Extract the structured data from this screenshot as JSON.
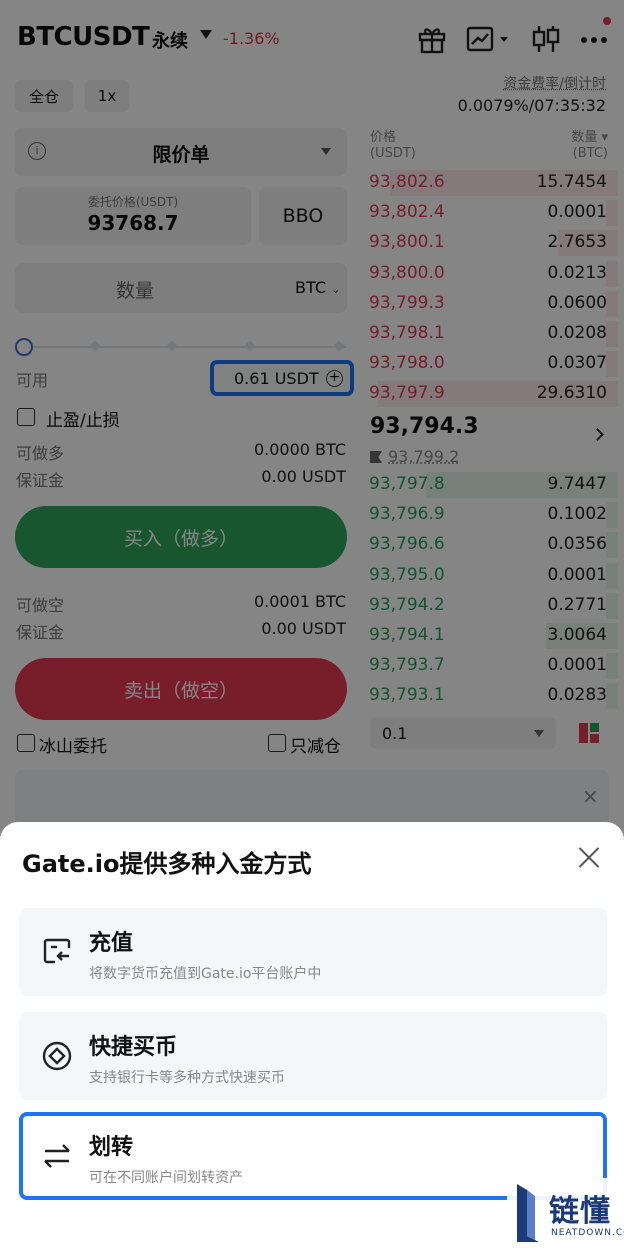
{
  "header": {
    "pair": "BTCUSDT",
    "contract_type": "永续",
    "change": "-1.36%",
    "funding_label": "资金费率/倒计时",
    "funding_value": "0.0079%/07:35:32",
    "icons": [
      "gift-icon",
      "chart-icon",
      "candlestick-icon",
      "more-icon"
    ]
  },
  "controls": {
    "margin_mode": "全仓",
    "leverage": "1x"
  },
  "order_form": {
    "order_type": "限价单",
    "price_label": "委托价格(USDT)",
    "price_value": "93768.7",
    "bbo": "BBO",
    "quantity_placeholder": "数量",
    "quantity_unit": "BTC",
    "available_label": "可用",
    "available_value": "0.61 USDT",
    "tp_sl": "止盈/止损",
    "long_max_label": "可做多",
    "long_max_value": "0.0000 BTC",
    "long_margin_label": "保证金",
    "long_margin_value": "0.00 USDT",
    "buy_button": "买入（做多）",
    "short_max_label": "可做空",
    "short_max_value": "0.0001 BTC",
    "short_margin_label": "保证金",
    "short_margin_value": "0.00 USDT",
    "sell_button": "卖出（做空）",
    "iceberg": "冰山委托",
    "reduce_only": "只减仓"
  },
  "orderbook": {
    "price_header": "价格\n(USDT)",
    "qty_header": "数量 ▾\n(BTC)",
    "asks": [
      {
        "price": "93,802.6",
        "qty": "15.7454",
        "depth": 0.95
      },
      {
        "price": "93,802.4",
        "qty": "0.0001",
        "depth": 0.05
      },
      {
        "price": "93,800.1",
        "qty": "2.7653",
        "depth": 0.25
      },
      {
        "price": "93,800.0",
        "qty": "0.0213",
        "depth": 0.05
      },
      {
        "price": "93,799.3",
        "qty": "0.0600",
        "depth": 0.05
      },
      {
        "price": "93,798.1",
        "qty": "0.0208",
        "depth": 0.05
      },
      {
        "price": "93,798.0",
        "qty": "0.0307",
        "depth": 0.05
      },
      {
        "price": "93,797.9",
        "qty": "29.6310",
        "depth": 1.0
      }
    ],
    "last_price": "93,794.3",
    "mark_price": "93,799.2",
    "bids": [
      {
        "price": "93,797.8",
        "qty": "9.7447",
        "depth": 0.8
      },
      {
        "price": "93,796.9",
        "qty": "0.1002",
        "depth": 0.05
      },
      {
        "price": "93,796.6",
        "qty": "0.0356",
        "depth": 0.05
      },
      {
        "price": "93,795.0",
        "qty": "0.0001",
        "depth": 0.05
      },
      {
        "price": "93,794.2",
        "qty": "0.2771",
        "depth": 0.05
      },
      {
        "price": "93,794.1",
        "qty": "3.0064",
        "depth": 0.3
      },
      {
        "price": "93,793.7",
        "qty": "0.0001",
        "depth": 0.05
      },
      {
        "price": "93,793.1",
        "qty": "0.0283",
        "depth": 0.05
      }
    ],
    "precision": "0.1"
  },
  "sheet": {
    "title": "Gate.io提供多种入金方式",
    "options": [
      {
        "title": "充值",
        "subtitle": "将数字货币充值到Gate.io平台账户中",
        "icon": "deposit-icon"
      },
      {
        "title": "快捷买币",
        "subtitle": "支持银行卡等多种方式快速买币",
        "icon": "buy-crypto-icon"
      },
      {
        "title": "划转",
        "subtitle": "可在不同账户间划转资产",
        "icon": "transfer-icon"
      }
    ]
  },
  "watermark": {
    "cn": "链懂",
    "en": "NEATDOWN.COM"
  },
  "colors": {
    "ask": "#e23c55",
    "bid": "#27a25b",
    "buy": "#2fa55a",
    "sell": "#e63a54",
    "highlight": "#1d74f5"
  }
}
